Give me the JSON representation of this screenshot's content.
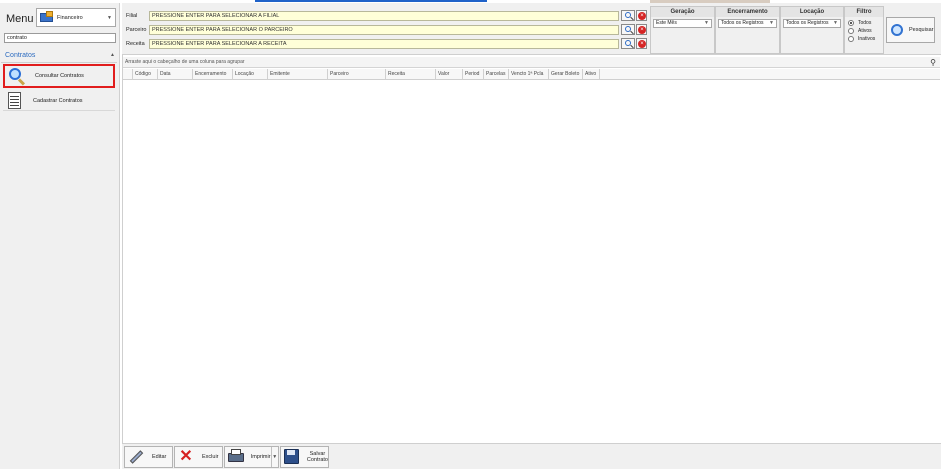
{
  "sidebar": {
    "menu_title": "Menu",
    "module": {
      "label": "Financeiro",
      "icon": "finance-module-icon"
    },
    "search_value": "contrato",
    "group": {
      "label": "Contratos",
      "collapse_icon": "▲"
    },
    "items": [
      {
        "label": "Consultar Contratos",
        "icon": "search-icon",
        "highlighted": true
      },
      {
        "label": "Cadastrar Contratos",
        "icon": "document-form-icon",
        "highlighted": false
      }
    ]
  },
  "filters": {
    "rows": [
      {
        "label": "Filial",
        "value": "PRESSIONE ENTER PARA SELECIONAR A FILIAL"
      },
      {
        "label": "Parceiro",
        "value": "PRESSIONE ENTER PARA SELECIONAR O PARCEIRO"
      },
      {
        "label": "Receita",
        "value": "PRESSIONE ENTER PARA SELECIONAR A RECEITA"
      }
    ],
    "geracao": {
      "title": "Geração",
      "value": "Este Mês"
    },
    "encerramento": {
      "title": "Encerramento",
      "value": "Todos os Registros"
    },
    "locacao": {
      "title": "Locação",
      "value": "Todos os Registros"
    },
    "filtro": {
      "title": "Filtro",
      "options": [
        "Todos",
        "Ativos",
        "Inativos"
      ],
      "selected": "Todos"
    },
    "search_button": "Pesquisar"
  },
  "grid": {
    "group_hint": "Arraste aqui o cabeçalho de uma coluna para agrupar",
    "columns": [
      "Código",
      "Data",
      "Encerramento",
      "Locação",
      "Emitente",
      "Parceiro",
      "Receita",
      "Valor",
      "Period",
      "Parcelas",
      "Vencto 1ª Pcla",
      "Gerar Boleto",
      "Ativo"
    ]
  },
  "toolbar": {
    "edit": "Editar",
    "delete": "Excluir",
    "print": "Imprimir",
    "save_line1": "Salvar",
    "save_line2": "Contrato"
  },
  "colors": {
    "highlight_border": "#e11d1d",
    "group_header_text": "#2d6cc0",
    "input_background": "#ffffd8",
    "top_accent": "#1f62c9"
  }
}
